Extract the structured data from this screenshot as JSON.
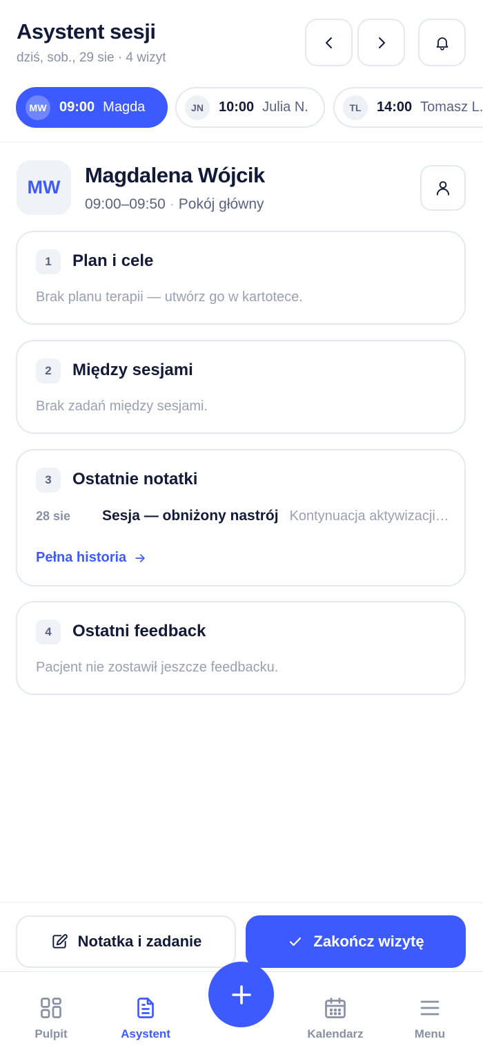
{
  "header": {
    "title": "Asystent sesji",
    "subtitle": "dziś, sob., 29 sie · 4 wizyt",
    "prev_icon": "chevron-left-icon",
    "next_icon": "chevron-right-icon",
    "bell_icon": "bell-icon"
  },
  "sessions": [
    {
      "initials": "MW",
      "time": "09:00",
      "name": "Magda",
      "active": true
    },
    {
      "initials": "JN",
      "time": "10:00",
      "name": "Julia N.",
      "active": false
    },
    {
      "initials": "TL",
      "time": "14:00",
      "name": "Tomasz L.",
      "active": false
    }
  ],
  "patient": {
    "initials": "MW",
    "name": "Magdalena Wójcik",
    "time_range": "09:00–09:50",
    "separator": "·",
    "room": "Pokój główny",
    "profile_icon": "user-icon"
  },
  "cards": {
    "plan": {
      "num": "1",
      "title": "Plan i cele",
      "empty": "Brak planu terapii — utwórz go w kartotece."
    },
    "between": {
      "num": "2",
      "title": "Między sesjami",
      "empty": "Brak zadań między sesjami."
    },
    "notes": {
      "num": "3",
      "title": "Ostatnie notatki",
      "items": [
        {
          "date": "28 sie",
          "title": "Sesja — obniżony nastrój",
          "desc": "Kontynuacja aktywizacji behawioralnej"
        }
      ],
      "history_link": "Pełna historia"
    },
    "feedback": {
      "num": "4",
      "title": "Ostatni feedback",
      "empty": "Pacjent nie zostawił jeszcze feedbacku."
    }
  },
  "actions": {
    "note_label": "Notatka i zadanie",
    "finish_label": "Zakończ wizytę"
  },
  "nav": {
    "items": [
      {
        "label": "Pulpit",
        "icon": "dashboard-icon",
        "active": false
      },
      {
        "label": "Asystent",
        "icon": "document-icon",
        "active": true
      },
      {
        "label": "Kalendarz",
        "icon": "calendar-icon",
        "active": false
      },
      {
        "label": "Menu",
        "icon": "menu-icon",
        "active": false
      }
    ],
    "fab_icon": "plus-icon"
  },
  "colors": {
    "accent": "#3d5afe",
    "text": "#131a38",
    "muted": "#8a8fa3",
    "border": "#e6e8ef"
  }
}
